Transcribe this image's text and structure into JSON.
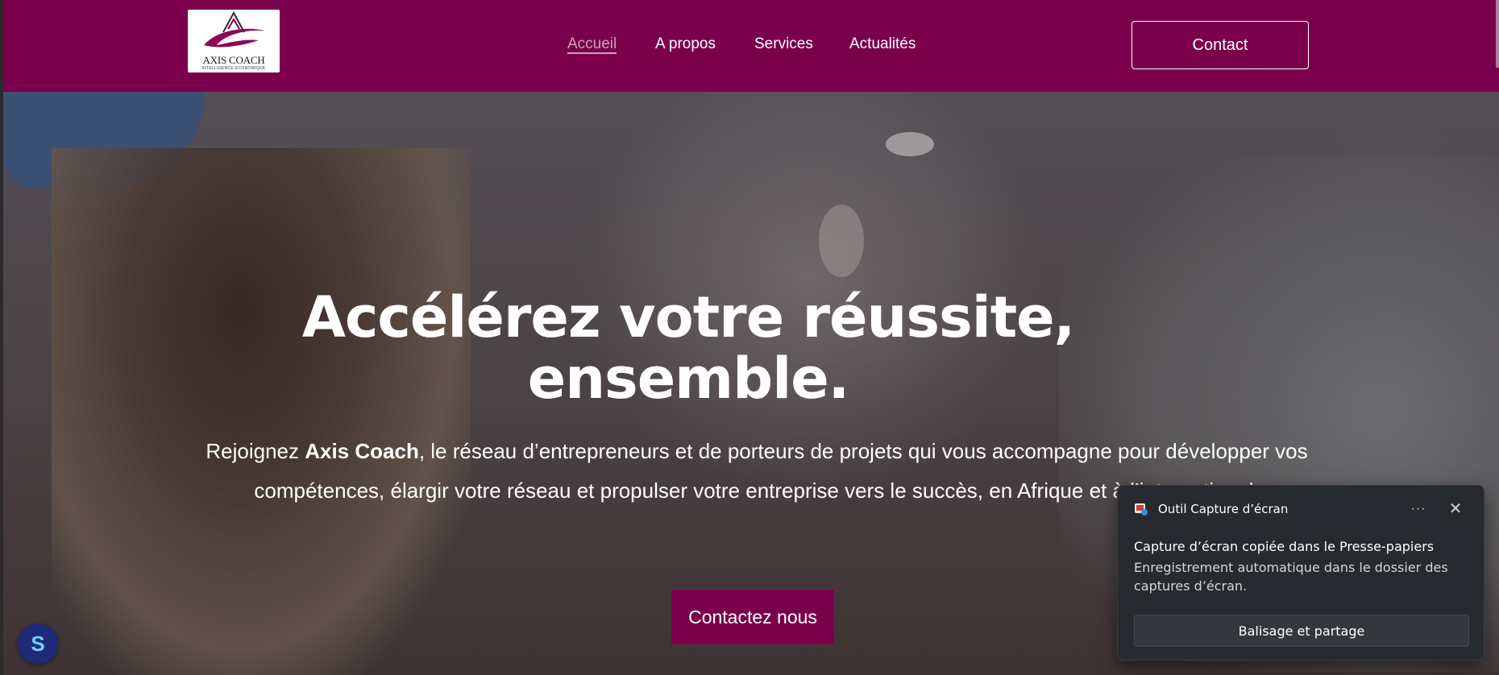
{
  "header": {
    "logo_text": "AXIS COACH",
    "logo_subtext": "INTELLIGENCE  ÉCONOMIQUE",
    "nav": [
      {
        "label": "Accueil",
        "active": true
      },
      {
        "label": "A propos",
        "active": false
      },
      {
        "label": "Services",
        "active": false
      },
      {
        "label": "Actualités",
        "active": false
      }
    ],
    "contact_label": "Contact"
  },
  "hero": {
    "title_line1": "Accélérez votre réussite,",
    "title_line2": "ensemble.",
    "subtitle_before": "Rejoignez ",
    "subtitle_brand": "Axis Coach",
    "subtitle_after": ", le réseau d’entrepreneurs et de porteurs de projets qui vous accompagne pour développer vos compétences, élargir votre réseau et propulser votre entreprise vers le succès, en Afrique et à l’international.",
    "cta_label": "Contactez nous"
  },
  "toast": {
    "app_name": "Outil Capture d’écran",
    "more_icon": "ellipsis-icon",
    "close_icon": "close-icon",
    "title": "Capture d’écran copiée dans le Presse-papiers",
    "body": "Enregistrement automatique dans le dossier des captures d’écran.",
    "action_label": "Balisage et partage"
  },
  "colors": {
    "brand": "#7b004c",
    "nav_active": "#c9a3b8",
    "toast_bg": "#272a2e"
  }
}
